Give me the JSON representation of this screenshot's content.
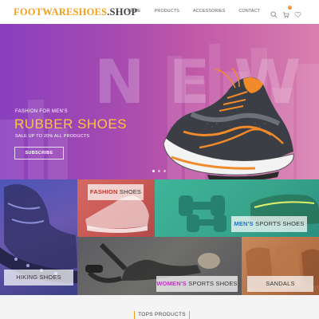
{
  "header": {
    "logo_part1": "FOOTWARESHOES",
    "logo_part2": ".SHOP",
    "nav": [
      "HOME",
      "PRODUCTS",
      "ACCESSORIES",
      "CONTACT"
    ],
    "icons": [
      "search-icon",
      "cart-icon",
      "heart-icon"
    ],
    "cart_count": "0"
  },
  "hero": {
    "big_word": "NEW",
    "pre_title": "FASHION FOR MEN'S",
    "title": "RUBBER SHOES",
    "sale": "SALE UP TO 20% ALL PRODUCTS",
    "button": "SUBSCRIBE",
    "active_slide": 1,
    "slides": 3
  },
  "categories": {
    "fashion": {
      "accent": "FASHION",
      "rest": " SHOES"
    },
    "mens": {
      "accent": "MEN'S",
      "rest": " SPORTS SHOES"
    },
    "hiking": {
      "text": "HIKING SHOES"
    },
    "women": {
      "accent": "WOMEN'S",
      "rest": " SPORTS SHOES"
    },
    "sandals": {
      "text": "SANDALS"
    }
  },
  "section": {
    "top_products": "TOPS PRODUCTS"
  },
  "colors": {
    "brand": "#f0a020",
    "hero_title": "#ffc43a",
    "fashion_accent": "#c0392b",
    "mens_accent": "#1f73c8",
    "women_accent": "#c231c2"
  }
}
